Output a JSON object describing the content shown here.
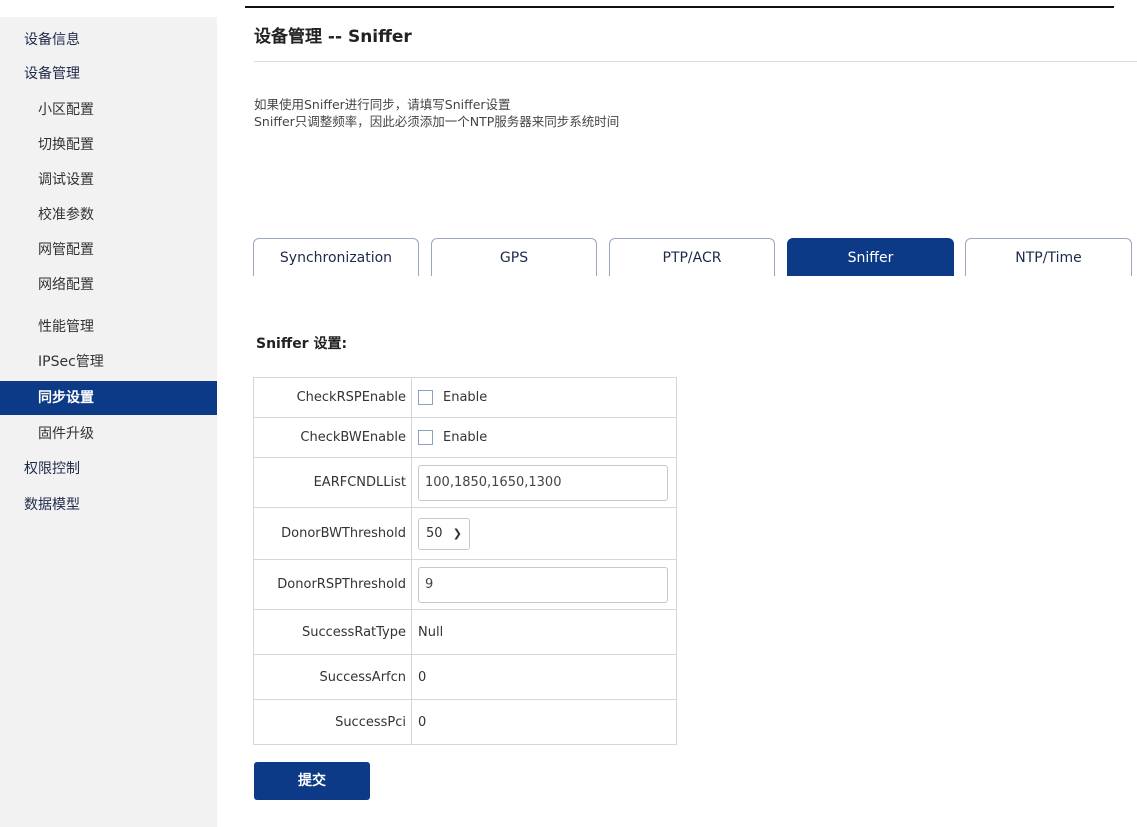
{
  "sidebar": {
    "items": [
      {
        "label": "设备信息"
      },
      {
        "label": "设备管理"
      },
      {
        "label": "小区配置"
      },
      {
        "label": "切换配置"
      },
      {
        "label": "调试设置"
      },
      {
        "label": "校准参数"
      },
      {
        "label": "网管配置"
      },
      {
        "label": "网络配置"
      },
      {
        "label": "性能管理"
      },
      {
        "label": "IPSec管理"
      },
      {
        "label": "同步设置"
      },
      {
        "label": "固件升级"
      },
      {
        "label": "权限控制"
      },
      {
        "label": "数据模型"
      }
    ],
    "active_item": "同步设置"
  },
  "header": {
    "title": "设备管理 -- Sniffer"
  },
  "description": {
    "line1": "如果使用Sniffer进行同步，请填写Sniffer设置",
    "line2": "Sniffer只调整频率，因此必须添加一个NTP服务器来同步系统时间"
  },
  "tabs": [
    {
      "label": "Synchronization"
    },
    {
      "label": "GPS"
    },
    {
      "label": "PTP/ACR"
    },
    {
      "label": "Sniffer"
    },
    {
      "label": "NTP/Time"
    }
  ],
  "active_tab": "Sniffer",
  "section": {
    "title": "Sniffer 设置:"
  },
  "form": {
    "check_rsp_enable": {
      "label": "CheckRSPEnable",
      "option": "Enable",
      "checked": false
    },
    "check_bw_enable": {
      "label": "CheckBWEnable",
      "option": "Enable",
      "checked": false
    },
    "earfcndl_list": {
      "label": "EARFCNDLList",
      "value": "100,1850,1650,1300"
    },
    "donor_bw_threshold": {
      "label": "DonorBWThreshold",
      "value": "50"
    },
    "donor_rsp_threshold": {
      "label": "DonorRSPThreshold",
      "value": "9"
    },
    "success_rat_type": {
      "label": "SuccessRatType",
      "value": "Null"
    },
    "success_arfcn": {
      "label": "SuccessArfcn",
      "value": "0"
    },
    "success_pci": {
      "label": "SuccessPci",
      "value": "0"
    }
  },
  "submit_label": "提交",
  "icons": {
    "dropdown": "chevron-down-icon"
  },
  "colors": {
    "primary": "#0d3a86",
    "sidebar_bg": "#f2f2f2"
  }
}
